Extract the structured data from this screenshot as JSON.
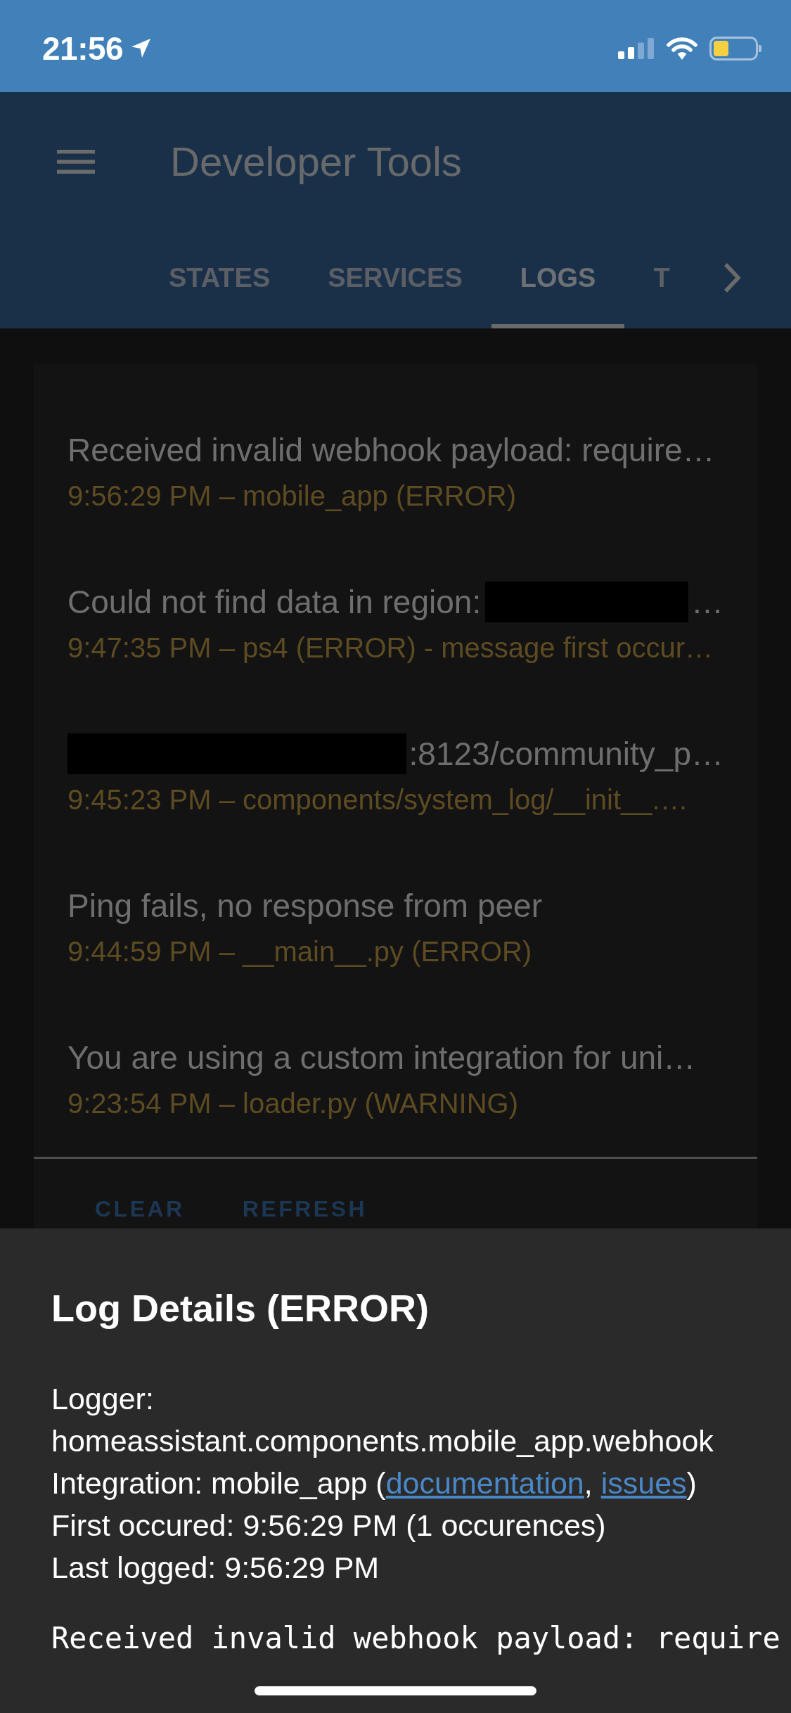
{
  "status_bar": {
    "time": "21:56"
  },
  "header": {
    "title": "Developer Tools",
    "tabs": [
      {
        "label": "STATES",
        "selected": false
      },
      {
        "label": "SERVICES",
        "selected": false
      },
      {
        "label": "LOGS",
        "selected": true
      },
      {
        "label": "T",
        "selected": false
      }
    ]
  },
  "log_card": {
    "entries": [
      {
        "message": [
          {
            "kind": "text",
            "text": "Received invalid webhook payload: require…"
          }
        ],
        "meta": "9:56:29 PM – mobile_app (ERROR)"
      },
      {
        "message": [
          {
            "kind": "text",
            "text": "Could not find data in region:"
          },
          {
            "kind": "redacted"
          },
          {
            "kind": "text",
            "text": "…"
          }
        ],
        "meta": "9:47:35 PM – ps4 (ERROR) - message first occur…"
      },
      {
        "message": [
          {
            "kind": "redacted"
          },
          {
            "kind": "text",
            "text": ":8123/community_p…"
          }
        ],
        "meta": "9:45:23 PM – components/system_log/__init__.…"
      },
      {
        "message": [
          {
            "kind": "text",
            "text": "Ping fails, no response from peer"
          }
        ],
        "meta": "9:44:59 PM – __main__.py (ERROR)"
      },
      {
        "message": [
          {
            "kind": "text",
            "text": "You are using a custom integration for uni…"
          }
        ],
        "meta": "9:23:54 PM – loader.py (WARNING)"
      }
    ],
    "actions": [
      "CLEAR",
      "REFRESH"
    ]
  },
  "log_details": {
    "title": "Log Details (ERROR)",
    "logger": "Logger: homeassistant.components.mobile_app.webhook",
    "integration": [
      {
        "kind": "text",
        "text": "Integration: mobile_app ("
      },
      {
        "kind": "link",
        "text": "documentation"
      },
      {
        "kind": "text",
        "text": ", "
      },
      {
        "kind": "link",
        "text": "issues"
      },
      {
        "kind": "text",
        "text": ")"
      }
    ],
    "first_occurred": "First occured: 9:56:29 PM (1 occurences)",
    "last_logged": "Last logged: 9:56:29 PM",
    "message": "Received invalid webhook payload: require"
  }
}
